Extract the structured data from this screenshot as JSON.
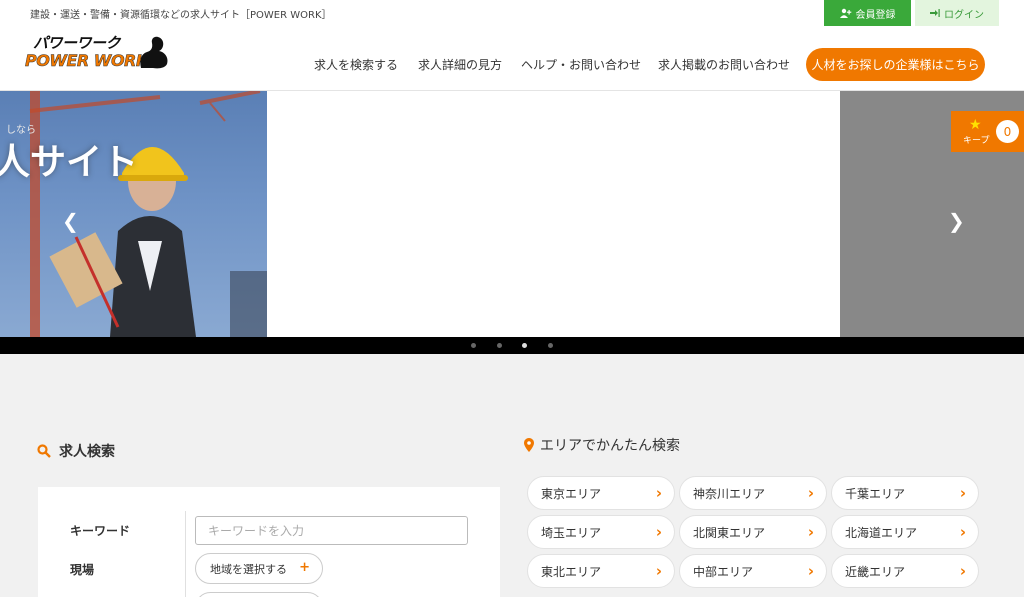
{
  "header": {
    "tagline": "建設・運送・警備・資源循環などの求人サイト［POWER WORK］",
    "register_label": "会員登録",
    "login_label": "ログイン",
    "logo_top": "パワーワーク",
    "logo_bottom": "POWER WORK",
    "nav": [
      "求人を検索する",
      "求人詳細の見方",
      "ヘルプ・お問い合わせ",
      "求人掲載のお問い合わせ"
    ],
    "cta_label": "人材をお探しの企業様はこちら"
  },
  "slider": {
    "left_text": "人サイト",
    "left_small": "しなら",
    "prev_icon": "chevron-left-icon",
    "next_icon": "chevron-right-icon",
    "dots_count": 4,
    "active_dot": 2
  },
  "keep": {
    "label": "キープ",
    "count": "0",
    "icon": "star-icon"
  },
  "search": {
    "title": "求人検索",
    "keyword_label": "キーワード",
    "keyword_placeholder": "キーワードを入力",
    "site_label": "現場",
    "region_button": "地域を選択する"
  },
  "area": {
    "title": "エリアでかんたん検索",
    "items": [
      "東京エリア",
      "神奈川エリア",
      "千葉エリア",
      "埼玉エリア",
      "北関東エリア",
      "北海道エリア",
      "東北エリア",
      "中部エリア",
      "近畿エリア"
    ]
  },
  "colors": {
    "accent": "#f07800",
    "green": "#3aa93a"
  }
}
